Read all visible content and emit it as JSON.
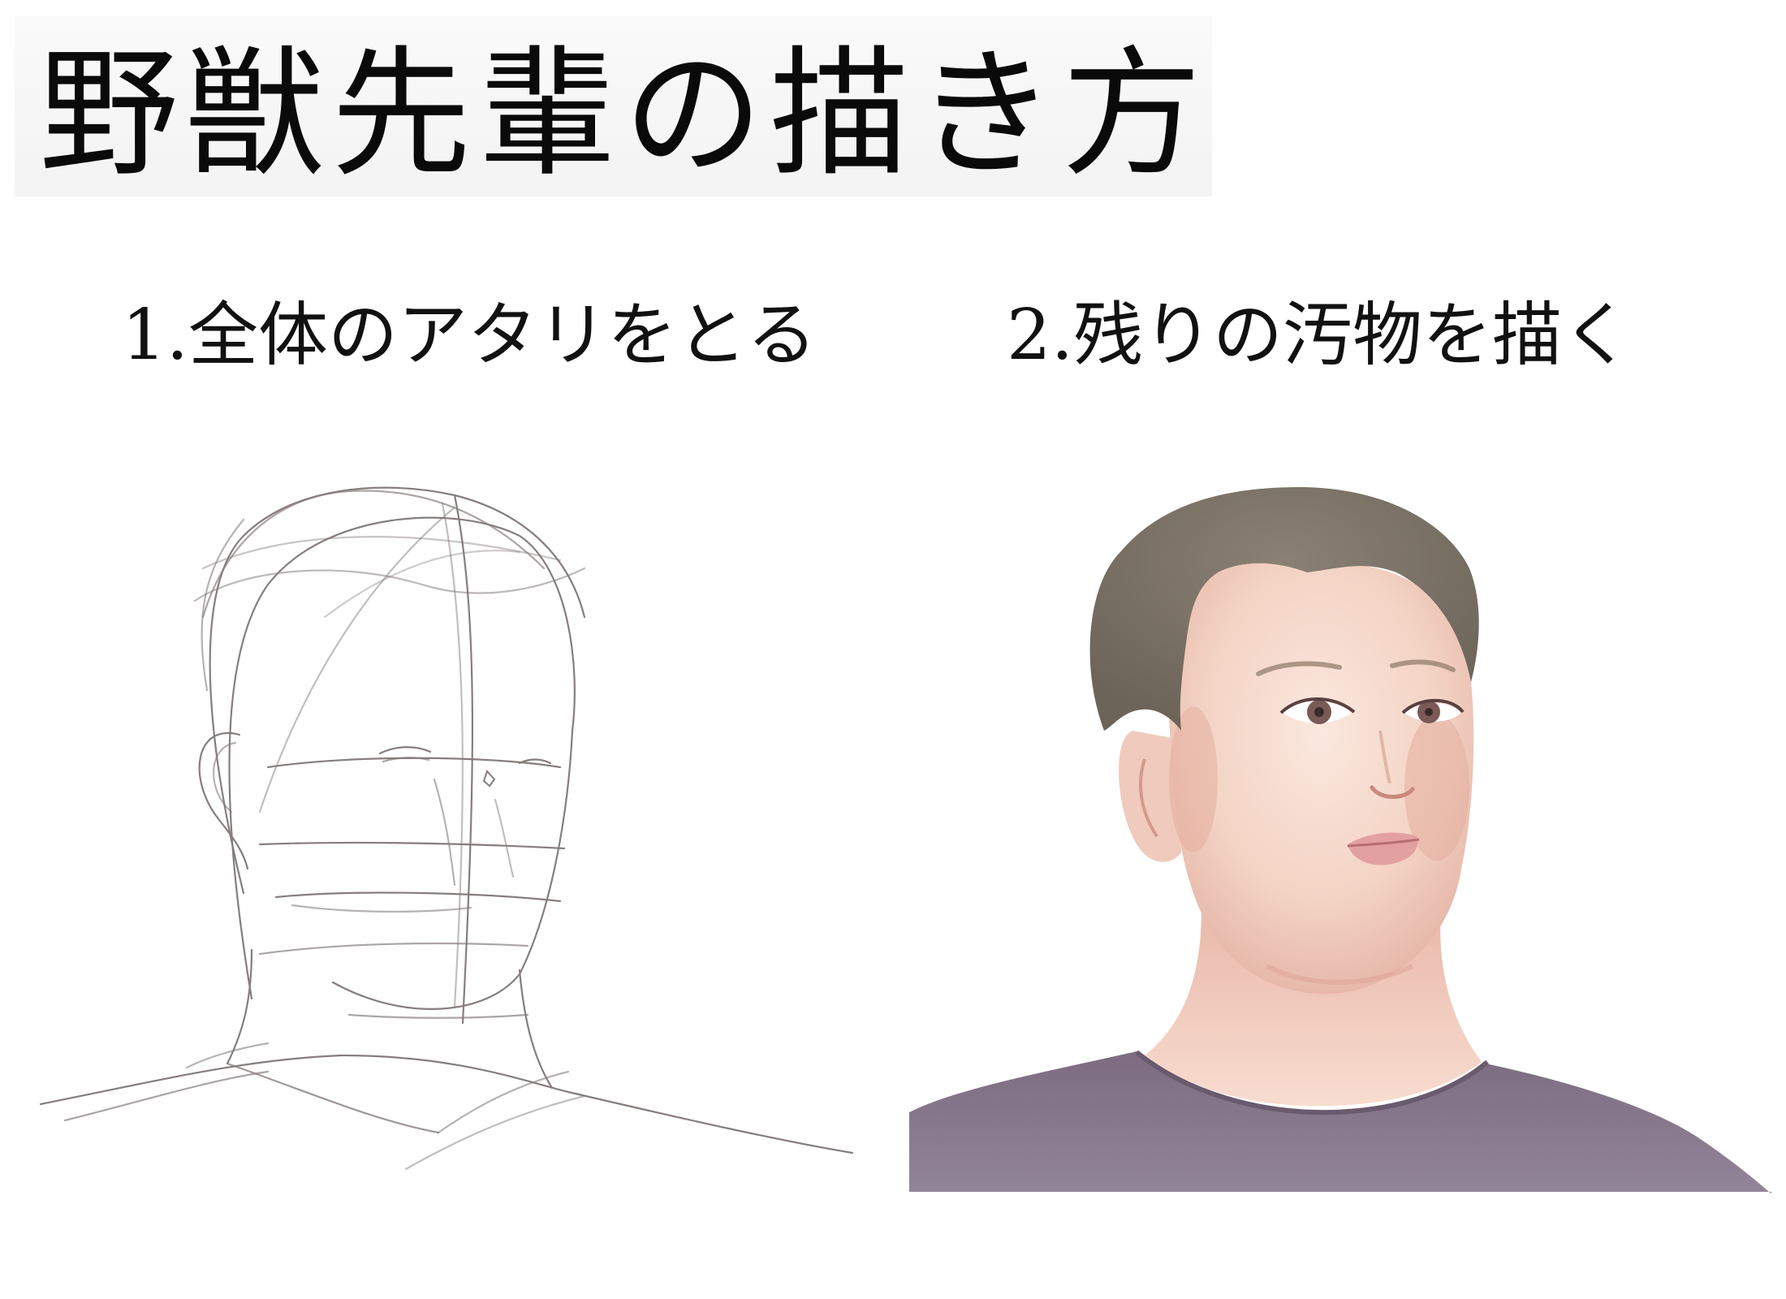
{
  "title": "野獣先輩の描き方",
  "steps": [
    {
      "label": "1.全体のアタリをとる"
    },
    {
      "label": "2.残りの汚物を描く"
    }
  ],
  "colors": {
    "sketch_line": "#7a6f6f",
    "hair": "#7b7166",
    "skin": "#f4d7c9",
    "shirt": "#7f6f82",
    "lips": "#e3a0a1",
    "iris": "#7a5a57"
  }
}
